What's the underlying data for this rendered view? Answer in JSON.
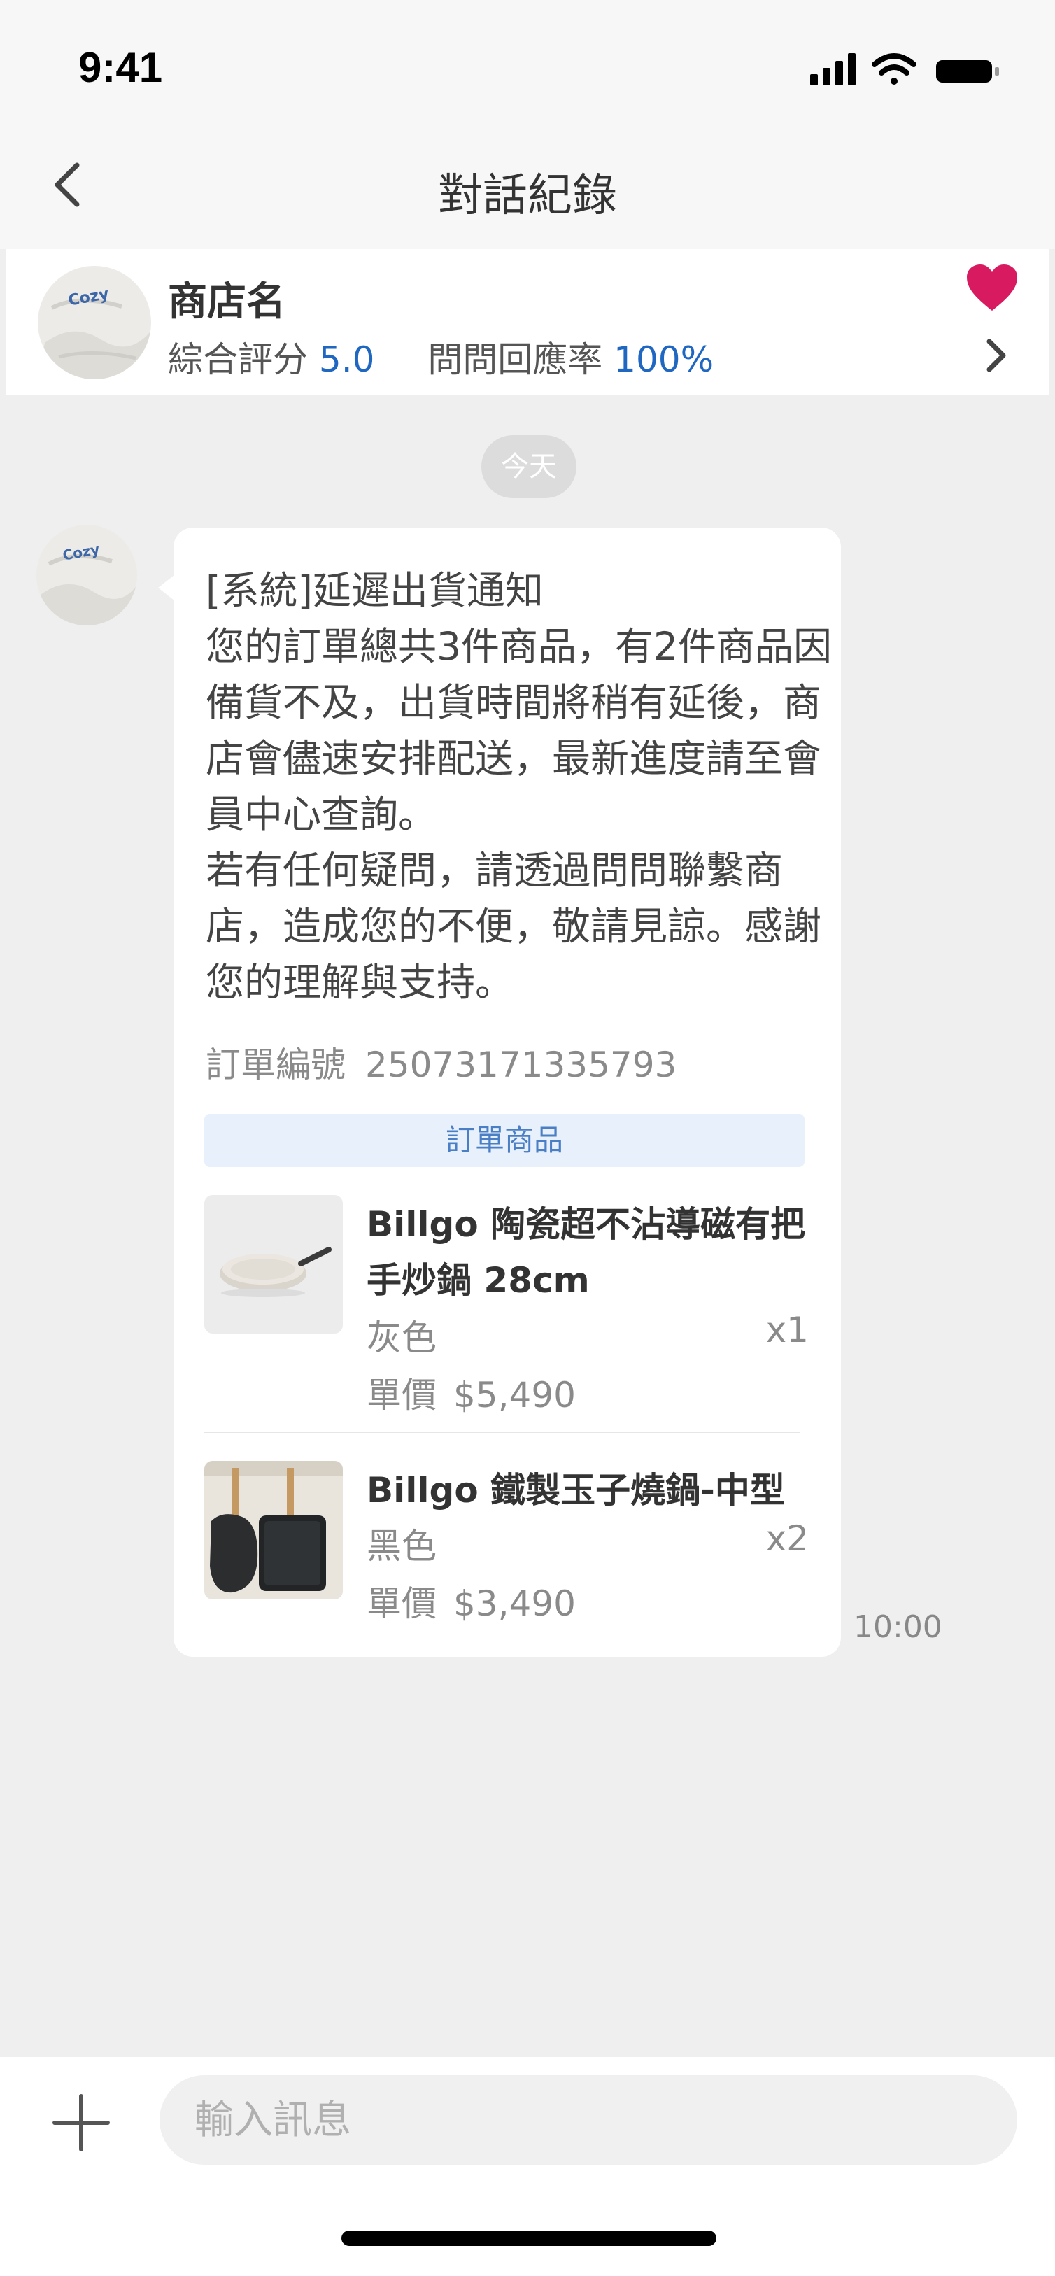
{
  "status_bar": {
    "time": "9:41",
    "icons": [
      "cellular-signal-icon",
      "wifi-icon",
      "battery-icon"
    ]
  },
  "nav": {
    "title": "對話紀錄",
    "back_icon": "chevron-left-icon"
  },
  "shop": {
    "name": "商店名",
    "rating_label": "綜合評分",
    "rating_value": "5.0",
    "response_label": "問問回應率",
    "response_value": "100%",
    "avatar_text": "Cozy",
    "favorite_icon": "heart-icon",
    "accent_color": "#d81b60",
    "link_color": "#1f67c1"
  },
  "chat": {
    "date_label": "今天",
    "message": {
      "text": "[系統]延遲出貨通知\n您的訂單總共3件商品，有2件商品因備貨不及，出貨時間將稍有延後，商店會儘速安排配送，最新進度請至會員中心查詢。\n若有任何疑問，請透過問問聯繫商店，造成您的不便，敬請見諒。感謝您的理解與支持。",
      "order_number_label": "訂單編號",
      "order_number": "25073171335793",
      "order_items_label": "訂單商品",
      "items": [
        {
          "name": "Billgo 陶瓷超不沾導磁有把手炒鍋 28cm",
          "variant": "灰色",
          "qty": "x1",
          "price_label": "單價",
          "price": "$5,490"
        },
        {
          "name": "Billgo 鐵製玉子燒鍋-中型",
          "variant": "黑色",
          "qty": "x2",
          "price_label": "單價",
          "price": "$3,490"
        }
      ],
      "time": "10:00"
    }
  },
  "composer": {
    "add_icon": "plus-icon",
    "placeholder": "輸入訊息"
  }
}
